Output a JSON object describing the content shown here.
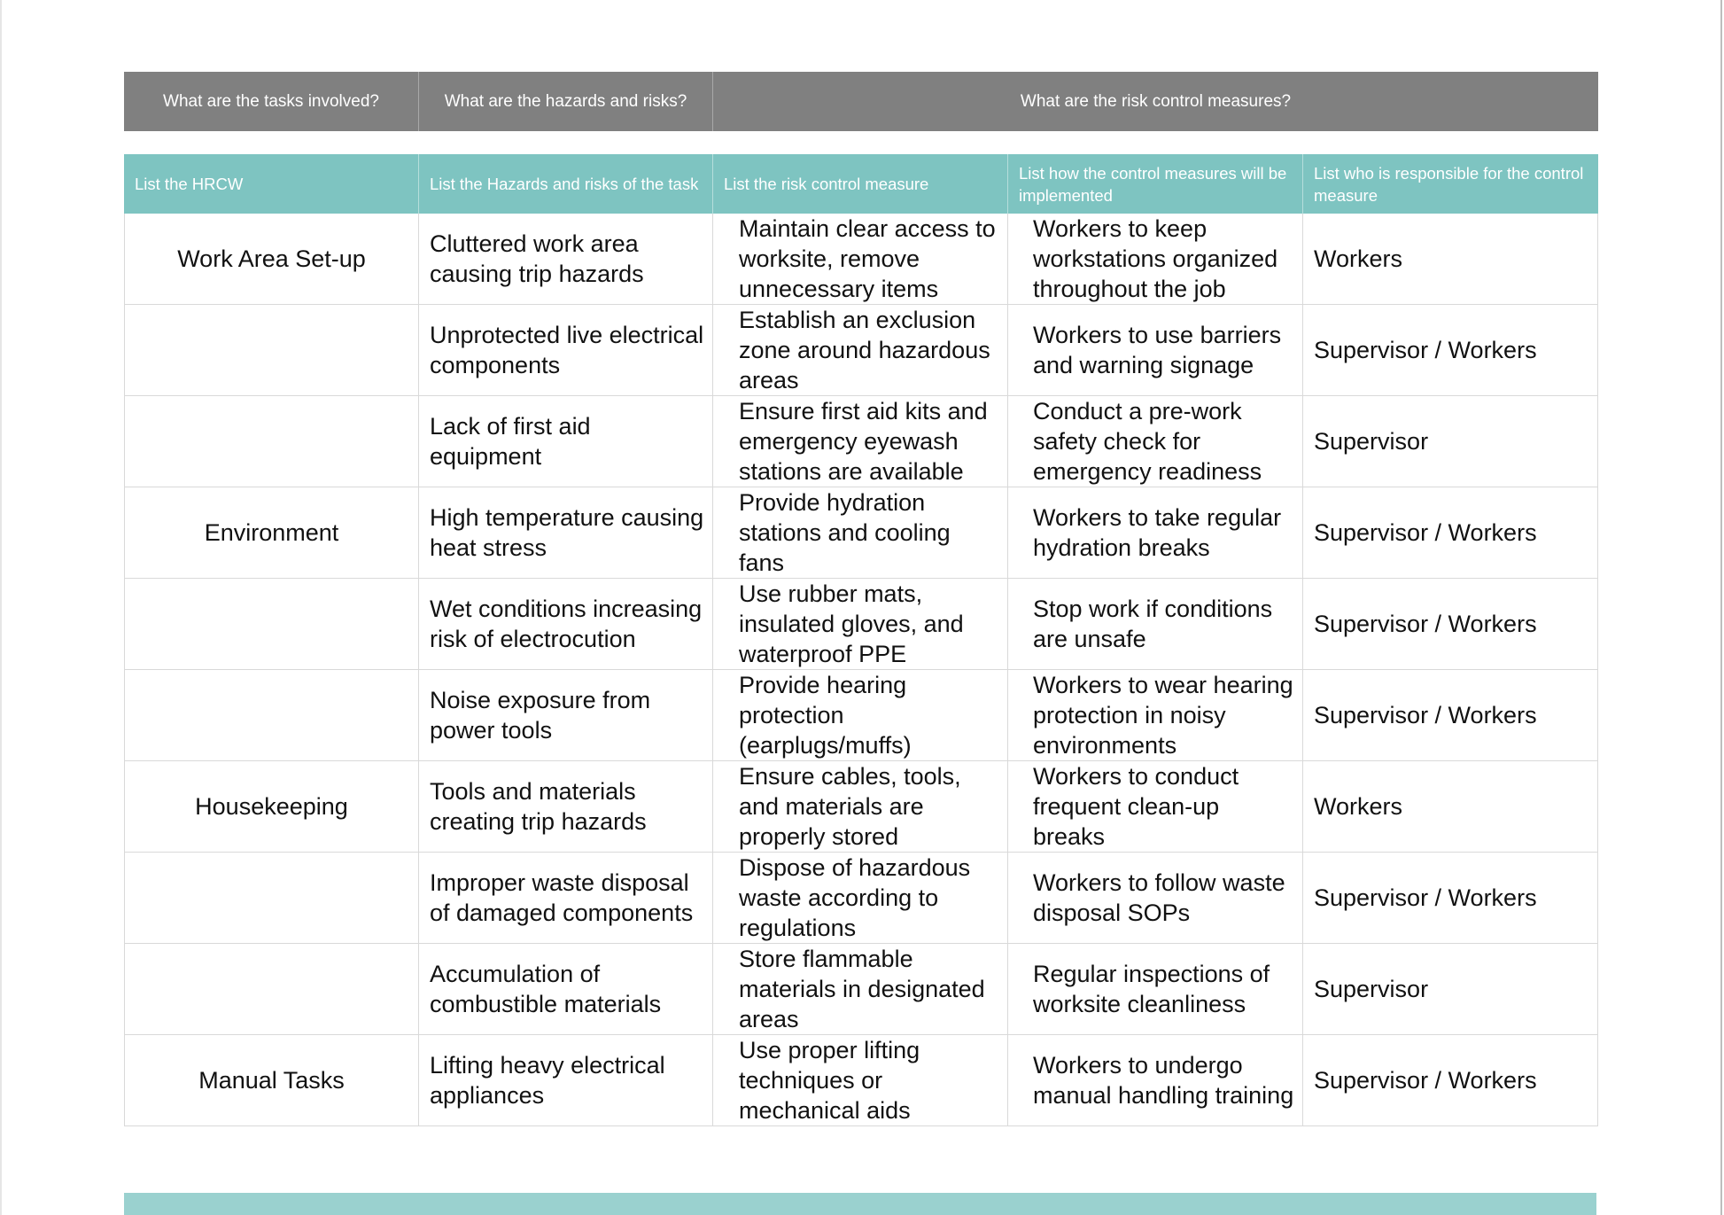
{
  "top_header": {
    "tasks": "What are the tasks involved?",
    "hazards": "What are the hazards and risks?",
    "controls": "What are the risk control measures?"
  },
  "sub_header": {
    "task": "List the HRCW",
    "hazard": "List the Hazards and risks of the task",
    "control": "List the risk control measure",
    "implementation": "List how the control measures will be implemented",
    "responsible": "List who is responsible for the control measure"
  },
  "rows": [
    {
      "task": "Work Area Set-up",
      "hazard": "Cluttered work area causing trip hazards",
      "control": "Maintain clear access to worksite, remove unnecessary items",
      "implementation": "Workers to keep workstations organized throughout the job",
      "responsible": "Workers"
    },
    {
      "task": "",
      "hazard": "Unprotected live electrical components",
      "control": "Establish an exclusion zone around hazardous areas",
      "implementation": "Workers to use barriers and warning signage",
      "responsible": "Supervisor / Workers"
    },
    {
      "task": "",
      "hazard": "Lack of first aid equipment",
      "control": "Ensure first aid kits and emergency eyewash stations are available",
      "implementation": "Conduct a pre-work safety check for emergency readiness",
      "responsible": "Supervisor"
    },
    {
      "task": "Environment",
      "hazard": "High temperature causing heat stress",
      "control": "Provide hydration stations and cooling fans",
      "implementation": "Workers to take regular hydration breaks",
      "responsible": "Supervisor / Workers"
    },
    {
      "task": "",
      "hazard": "Wet conditions increasing risk of electrocution",
      "control": "Use rubber mats, insulated gloves, and waterproof PPE",
      "implementation": "Stop work if conditions are unsafe",
      "responsible": "Supervisor / Workers"
    },
    {
      "task": "",
      "hazard": "Noise exposure from power tools",
      "control": "Provide hearing protection (earplugs/muffs)",
      "implementation": "Workers to wear hearing protection in noisy environments",
      "responsible": "Supervisor / Workers"
    },
    {
      "task": "Housekeeping",
      "hazard": "Tools and materials creating trip hazards",
      "control": "Ensure cables, tools, and materials are properly stored",
      "implementation": "Workers to conduct frequent clean-up breaks",
      "responsible": "Workers"
    },
    {
      "task": "",
      "hazard": "Improper waste disposal of damaged components",
      "control": "Dispose of hazardous waste according to regulations",
      "implementation": "Workers to follow waste disposal SOPs",
      "responsible": "Supervisor / Workers"
    },
    {
      "task": "",
      "hazard": "Accumulation of combustible materials",
      "control": "Store flammable materials in designated areas",
      "implementation": "Regular inspections of worksite cleanliness",
      "responsible": "Supervisor"
    },
    {
      "task": "Manual Tasks",
      "hazard": "Lifting heavy electrical appliances",
      "control": "Use proper lifting techniques or mechanical aids",
      "implementation": "Workers to undergo manual handling training",
      "responsible": "Supervisor / Workers"
    }
  ],
  "colors": {
    "top_header_bg": "#808080",
    "sub_header_bg": "#7ec4c1",
    "footer_bar": "#9ad1cf"
  }
}
